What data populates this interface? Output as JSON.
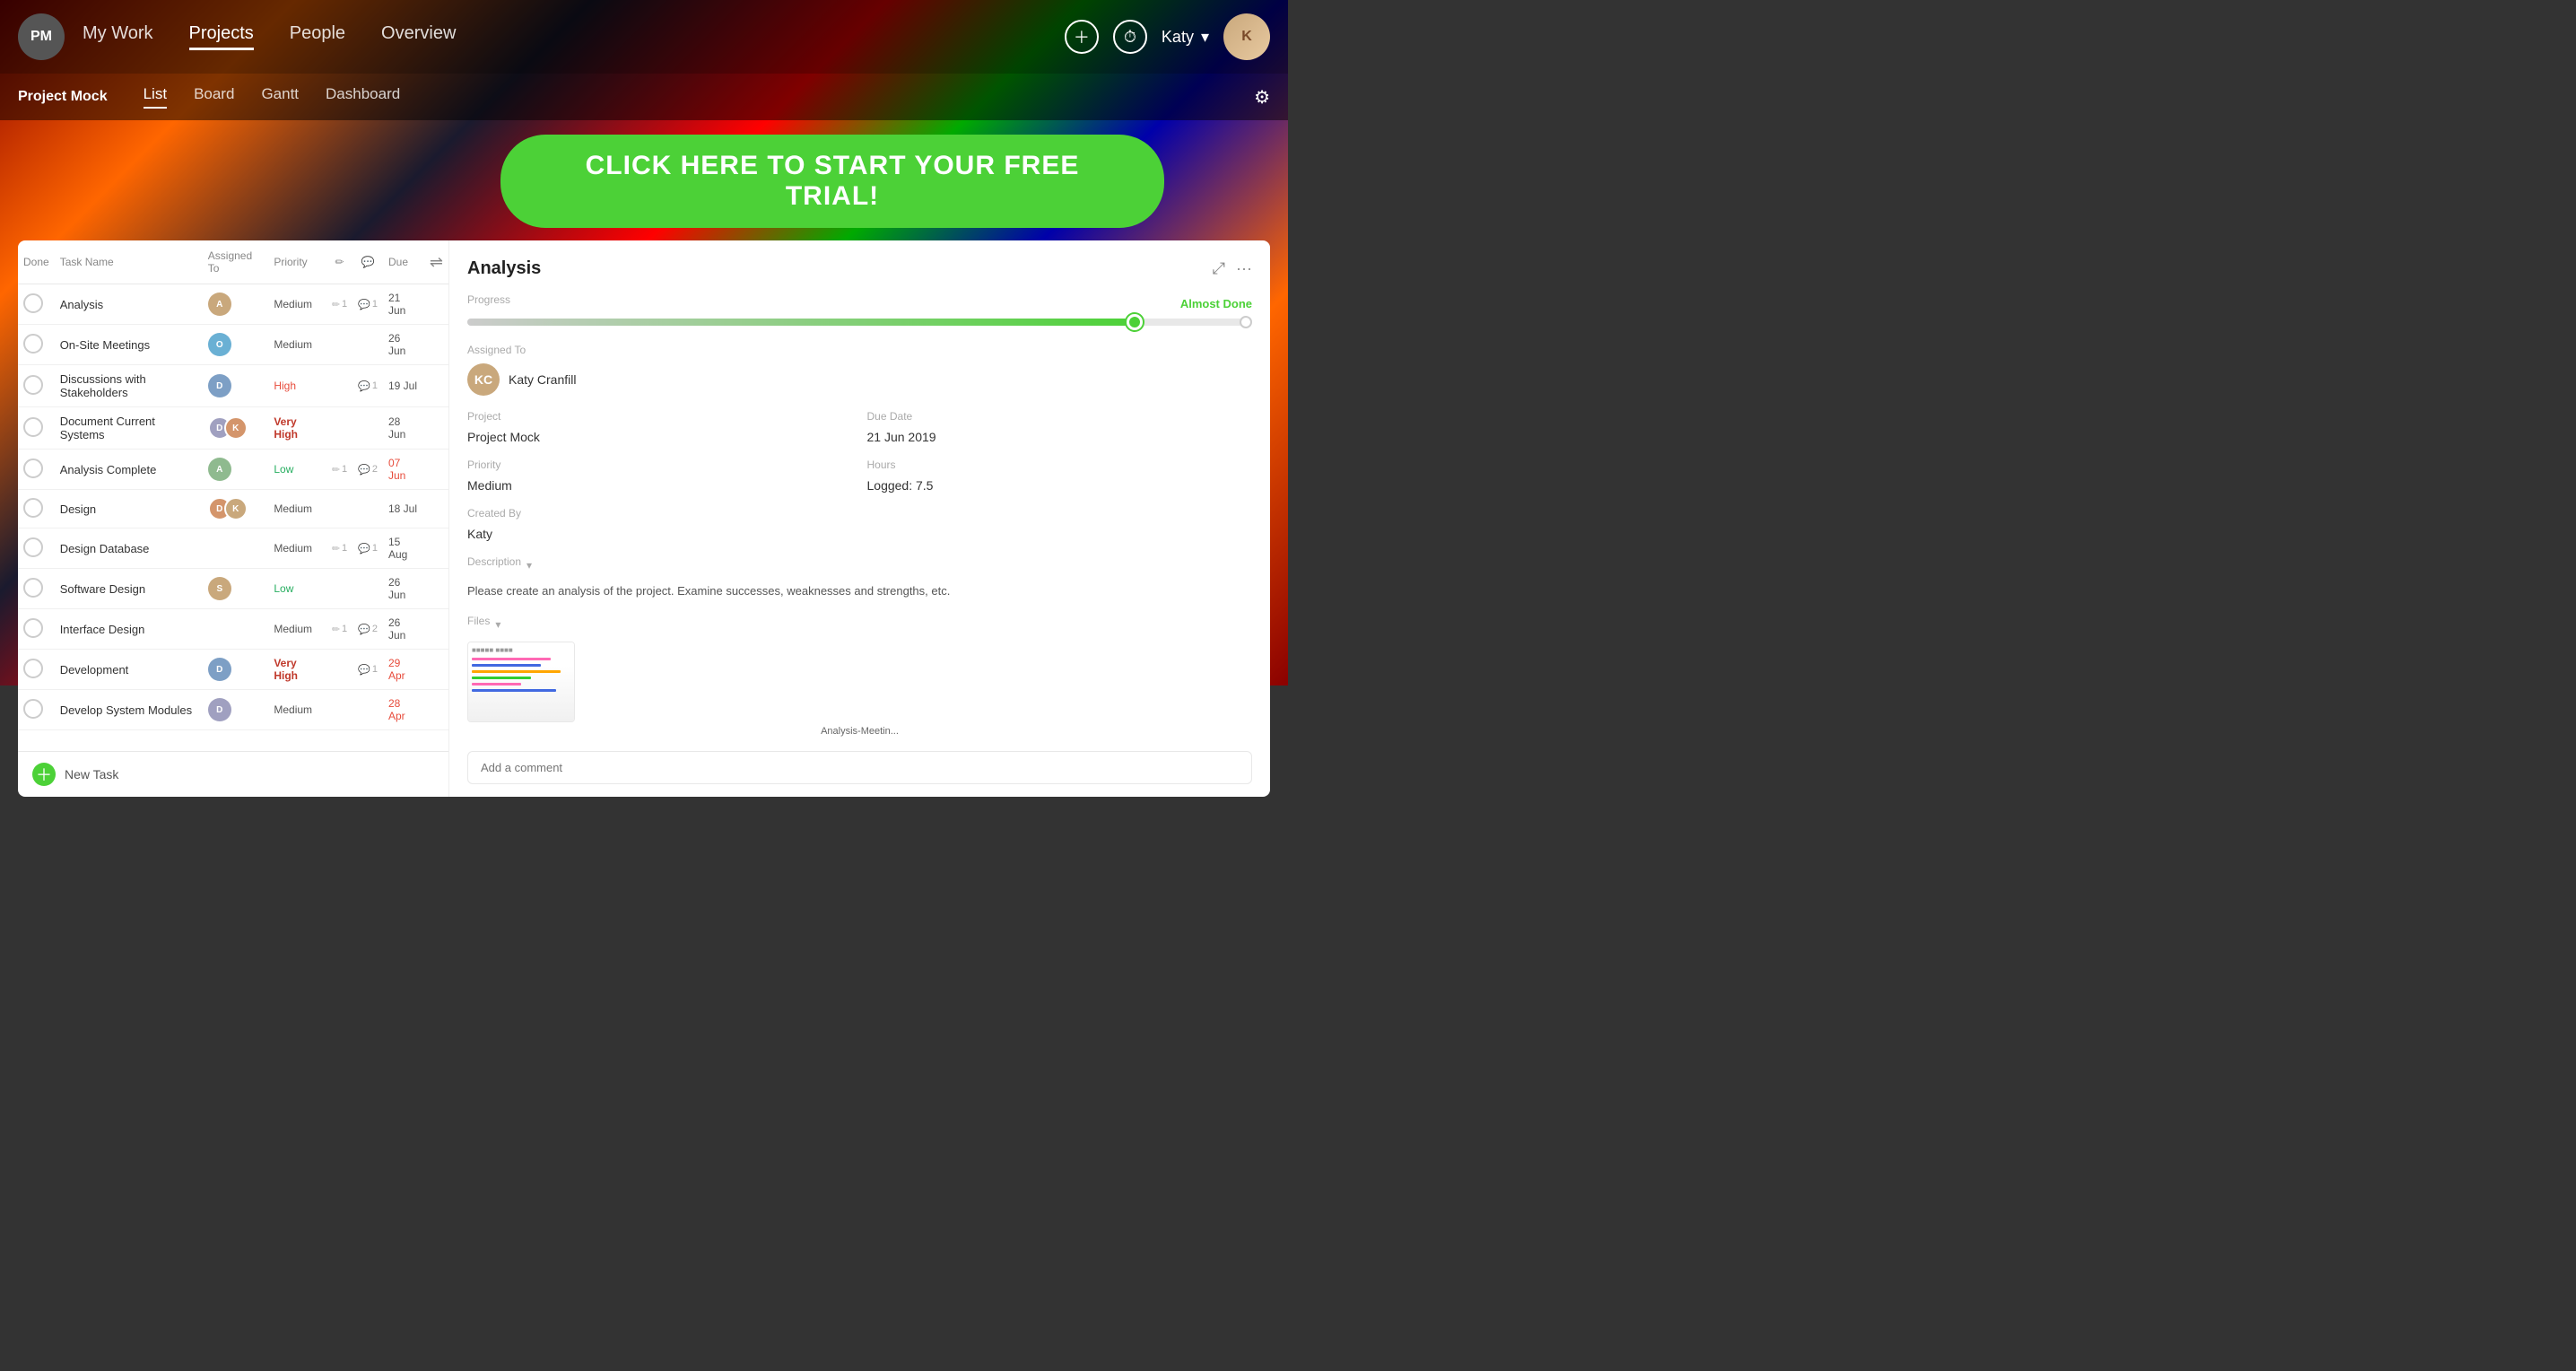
{
  "logo": {
    "text": "PM"
  },
  "nav": {
    "links": [
      "My Work",
      "Projects",
      "People",
      "Overview"
    ],
    "active": "Projects"
  },
  "project": {
    "title": "Project Mock"
  },
  "sub_nav": {
    "links": [
      "List",
      "Board",
      "Gantt",
      "Dashboard"
    ],
    "active": "List"
  },
  "cta": {
    "label": "CLICK HERE TO START YOUR FREE TRIAL!"
  },
  "table": {
    "headers": {
      "done": "Done",
      "task_name": "Task Name",
      "assigned_to": "Assigned To",
      "priority": "Priority",
      "pencil": "✏",
      "comment": "💬",
      "due": "Due"
    },
    "rows": [
      {
        "id": 1,
        "name": "Analysis",
        "assigned": "single",
        "priority": "Medium",
        "pencil": 1,
        "comment": 1,
        "due": "21 Jun",
        "overdue": false
      },
      {
        "id": 2,
        "name": "On-Site Meetings",
        "assigned": "single",
        "priority": "Medium",
        "pencil": 0,
        "comment": 0,
        "due": "26 Jun",
        "overdue": false
      },
      {
        "id": 3,
        "name": "Discussions with Stakeholders",
        "assigned": "single",
        "priority": "High",
        "pencil": 0,
        "comment": 1,
        "due": "19 Jul",
        "overdue": false
      },
      {
        "id": 4,
        "name": "Document Current Systems",
        "assigned": "double",
        "priority": "Very High",
        "pencil": 0,
        "comment": 0,
        "due": "28 Jun",
        "overdue": false
      },
      {
        "id": 5,
        "name": "Analysis Complete",
        "assigned": "single",
        "priority": "Low",
        "pencil": 1,
        "comment": 2,
        "due": "07 Jun",
        "overdue": true
      },
      {
        "id": 6,
        "name": "Design",
        "assigned": "double",
        "priority": "Medium",
        "pencil": 0,
        "comment": 0,
        "due": "18 Jul",
        "overdue": false
      },
      {
        "id": 7,
        "name": "Design Database",
        "assigned": "none",
        "priority": "Medium",
        "pencil": 1,
        "comment": 1,
        "due": "15 Aug",
        "overdue": false
      },
      {
        "id": 8,
        "name": "Software Design",
        "assigned": "single",
        "priority": "Low",
        "pencil": 0,
        "comment": 0,
        "due": "26 Jun",
        "overdue": false
      },
      {
        "id": 9,
        "name": "Interface Design",
        "assigned": "none",
        "priority": "Medium",
        "pencil": 1,
        "comment": 2,
        "due": "26 Jun",
        "overdue": false
      },
      {
        "id": 10,
        "name": "Development",
        "assigned": "single",
        "priority": "Very High",
        "pencil": 0,
        "comment": 1,
        "due": "29 Apr",
        "overdue": true
      },
      {
        "id": 11,
        "name": "Develop System Modules",
        "assigned": "single",
        "priority": "Medium",
        "pencil": 0,
        "comment": 0,
        "due": "28 Apr",
        "overdue": true
      }
    ]
  },
  "new_task_label": "New Task",
  "analysis": {
    "title": "Analysis",
    "progress_label": "Progress",
    "progress_status": "Almost Done",
    "project_label": "Project",
    "project_value": "Project Mock",
    "priority_label": "Priority",
    "priority_value": "Medium",
    "assigned_label": "Assigned To",
    "assigned_name": "Katy Cranfill",
    "due_label": "Due Date",
    "due_value": "21 Jun 2019",
    "hours_label": "Hours",
    "logged_label": "Logged:",
    "logged_value": "7.5",
    "created_label": "Created By",
    "created_value": "Katy",
    "description_label": "Description",
    "description_text": "Please create an analysis of the project. Examine successes, weaknesses and strengths, etc.",
    "files_label": "Files",
    "file_name": "Analysis-Meetin...",
    "comment_placeholder": "Add a comment"
  },
  "user": {
    "name": "Katy"
  }
}
